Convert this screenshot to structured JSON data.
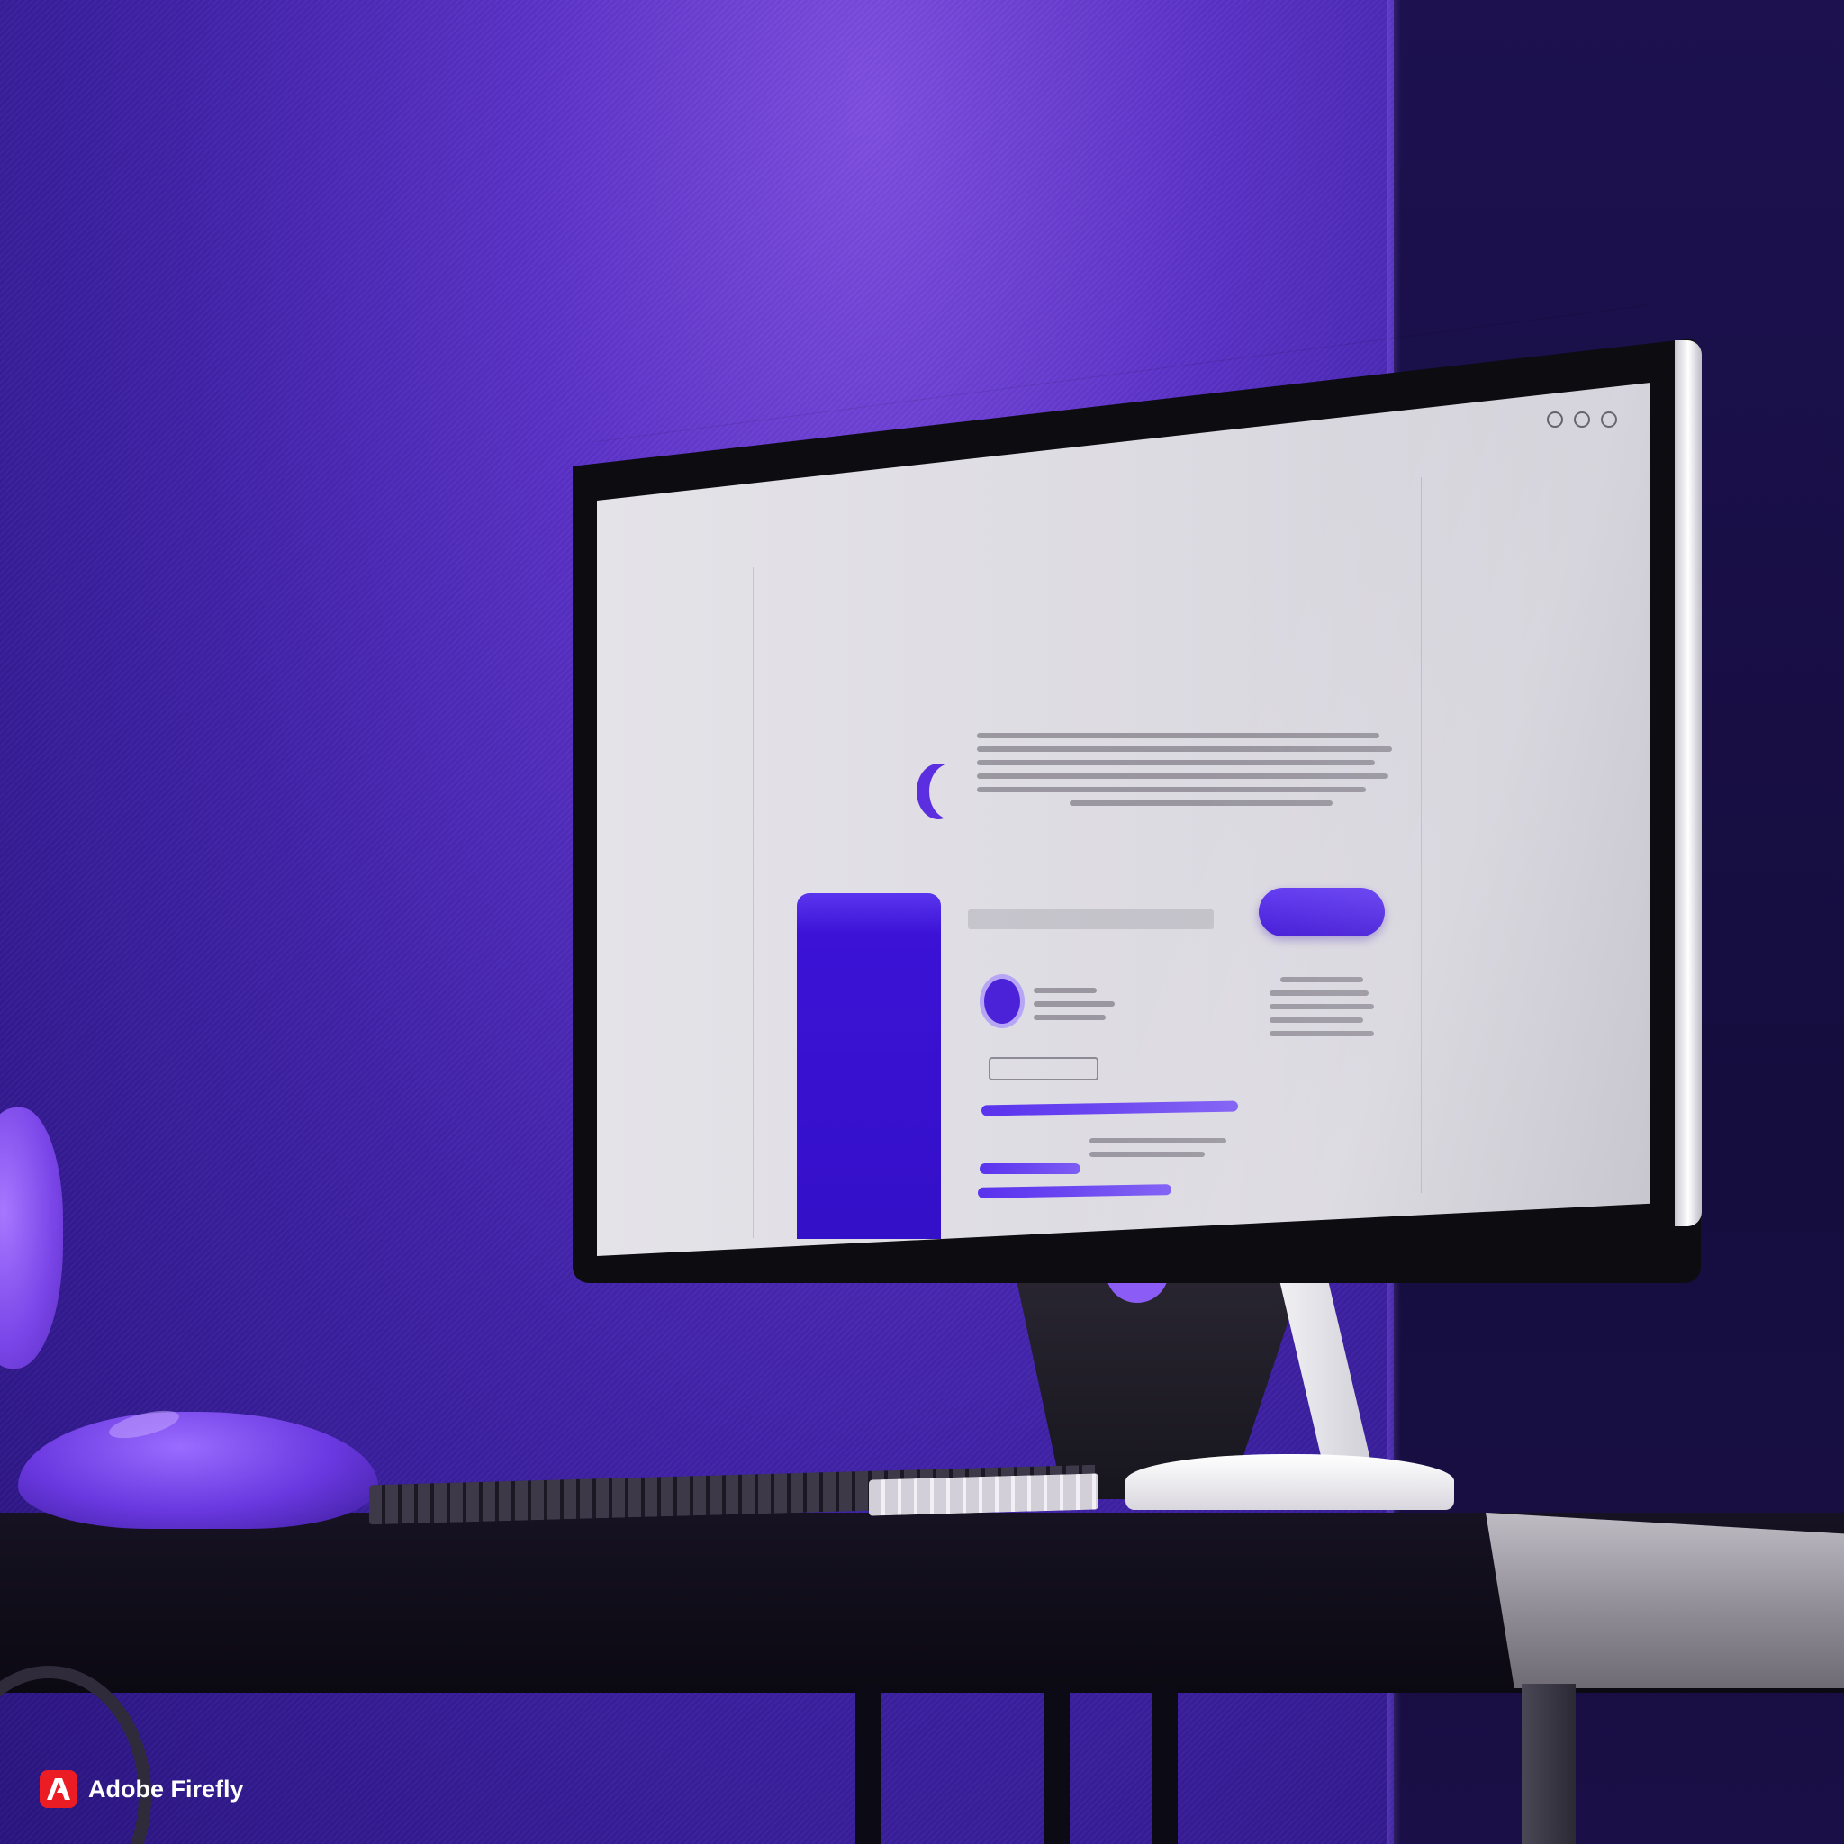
{
  "watermark": {
    "text": "Adobe Firefly"
  },
  "monitor_ui": {
    "logo": "",
    "nav": [
      "",
      ""
    ],
    "eyebrow": "",
    "headline": "",
    "sidecard_label": "",
    "tag": "",
    "cta": "",
    "search": "",
    "pill": "",
    "stat_label": "",
    "footer": ""
  },
  "colors": {
    "wall": "#5b32c8",
    "accent": "#3f14d6",
    "screen": "#dcdae1",
    "desk": "#0b0912",
    "watermark_badge": "#eb1c24"
  },
  "icons": [
    "adobe-logo-icon",
    "header-icon",
    "crescent-logo-icon",
    "avatar-icon"
  ]
}
